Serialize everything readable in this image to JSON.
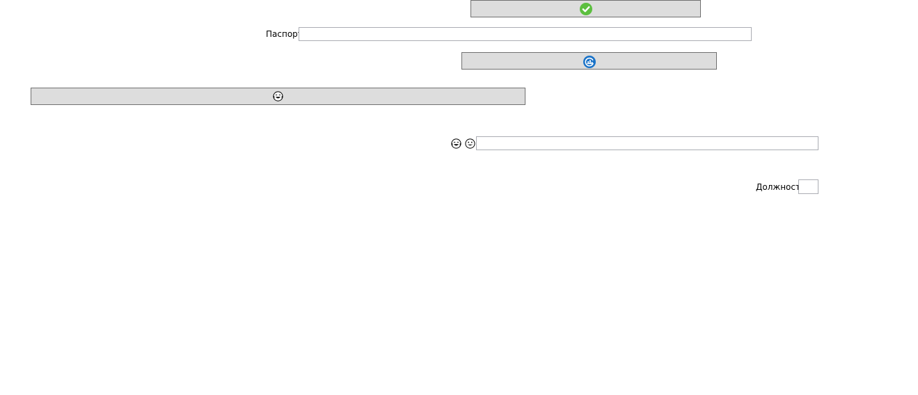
{
  "form": {
    "passport_label": "Паспорт",
    "passport_value": "",
    "position_label": "Должность",
    "position_value": "",
    "emoji_field_value": ""
  },
  "icons": {
    "confirm": "check-circle-icon",
    "refresh": "refresh-circle-icon",
    "laugh_button": "face-with-tears-of-joy-icon",
    "laugh_small": "face-with-tears-of-joy-icon",
    "grin_small": "grinning-face-icon"
  },
  "colors": {
    "confirm_green": "#5cbf3f",
    "refresh_blue": "#1a73c8",
    "button_bg": "#dddddd",
    "button_border": "#707070",
    "field_border": "#abadb3"
  }
}
